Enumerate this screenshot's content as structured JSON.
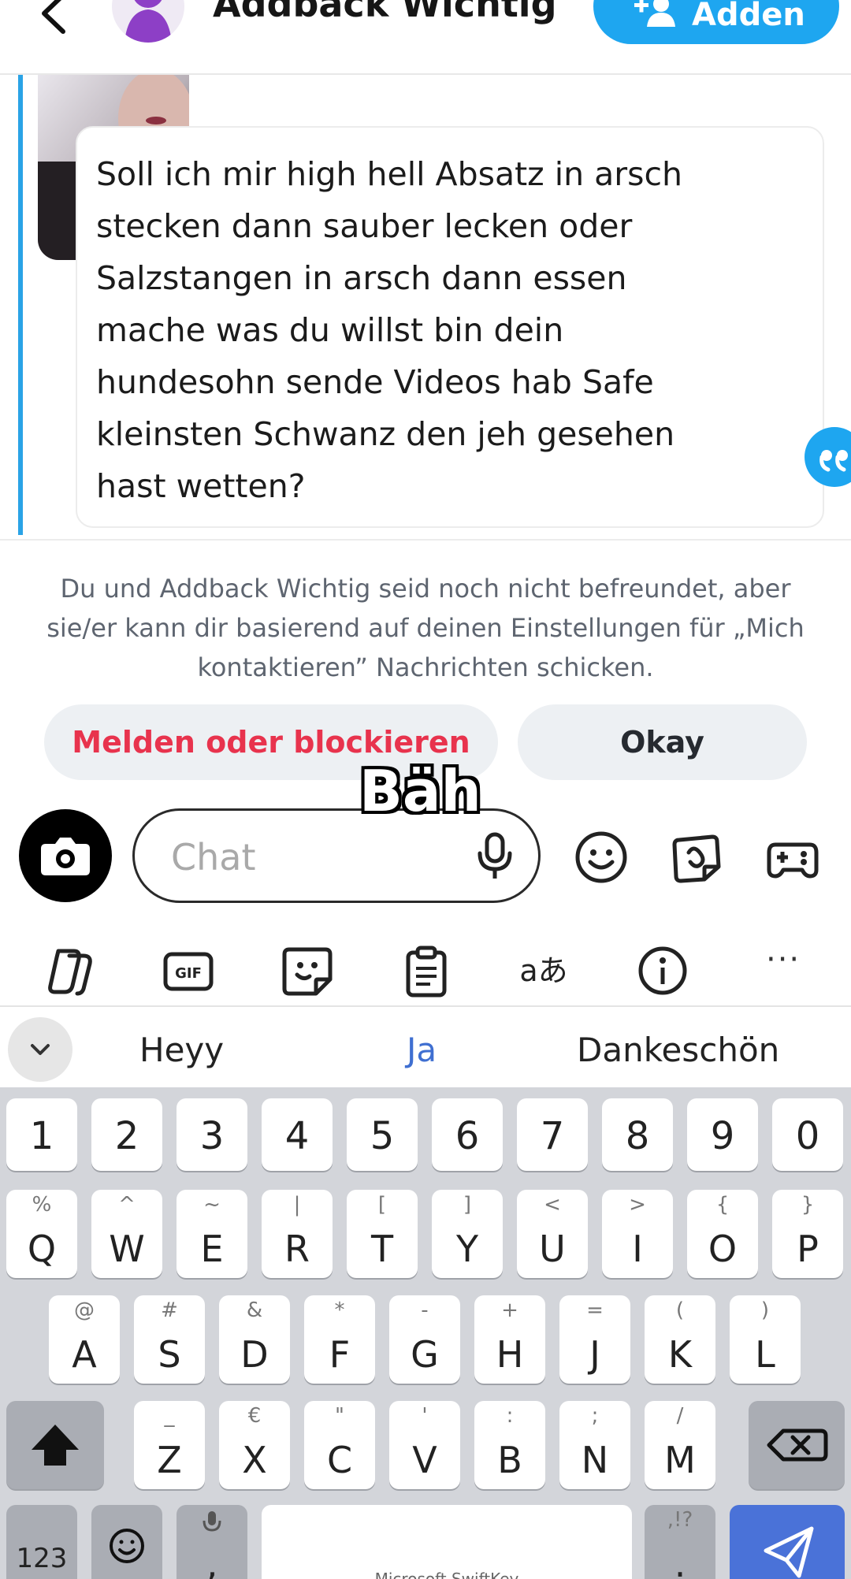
{
  "header": {
    "title": "Addback Wichtig",
    "add_label": "Adden"
  },
  "message": {
    "text": "Soll ich mir high hell Absatz in arsch stecken dann sauber lecken oder Salzstangen in arsch dann essen mache was du willst bin dein hundesohn sende Videos hab Safe kleinsten Schwanz den jeh gesehen hast wetten?"
  },
  "notice": {
    "text": "Du und Addback Wichtig seid noch nicht befreundet, aber sie/er kann dir basierend auf deinen Einstellungen für „Mich kontaktieren” Nachrichten schicken.",
    "report_label": "Melden oder blockieren",
    "okay_label": "Okay"
  },
  "caption": "Bäh",
  "chat": {
    "placeholder": "Chat"
  },
  "keyboard_toolbar": {
    "gif_label": "GIF",
    "translate_label": "aあ",
    "more_label": "···"
  },
  "suggestions": [
    "Heyy",
    "Ja",
    "Dankeschön"
  ],
  "keys": {
    "numbers": [
      "1",
      "2",
      "3",
      "4",
      "5",
      "6",
      "7",
      "8",
      "9",
      "0"
    ],
    "row1": [
      {
        "main": "Q",
        "sub": "%"
      },
      {
        "main": "W",
        "sub": "^"
      },
      {
        "main": "E",
        "sub": "~"
      },
      {
        "main": "R",
        "sub": "|"
      },
      {
        "main": "T",
        "sub": "["
      },
      {
        "main": "Y",
        "sub": "]"
      },
      {
        "main": "U",
        "sub": "<"
      },
      {
        "main": "I",
        "sub": ">"
      },
      {
        "main": "O",
        "sub": "{"
      },
      {
        "main": "P",
        "sub": "}"
      }
    ],
    "row2": [
      {
        "main": "A",
        "sub": "@"
      },
      {
        "main": "S",
        "sub": "#"
      },
      {
        "main": "D",
        "sub": "&"
      },
      {
        "main": "F",
        "sub": "*"
      },
      {
        "main": "G",
        "sub": "-"
      },
      {
        "main": "H",
        "sub": "+"
      },
      {
        "main": "J",
        "sub": "="
      },
      {
        "main": "K",
        "sub": "("
      },
      {
        "main": "L",
        "sub": ")"
      }
    ],
    "row3": [
      {
        "main": "Z",
        "sub": "_"
      },
      {
        "main": "X",
        "sub": "€"
      },
      {
        "main": "C",
        "sub": "\""
      },
      {
        "main": "V",
        "sub": "'"
      },
      {
        "main": "B",
        "sub": ":"
      },
      {
        "main": "N",
        "sub": ";"
      },
      {
        "main": "M",
        "sub": "/"
      }
    ],
    "bottom": {
      "numbers_label": "123",
      "comma_label": ",",
      "space_brand": "Microsoft SwiftKey",
      "period_label": ".",
      "period_sub": ",!?"
    }
  },
  "colors": {
    "accent_blue": "#1ea6f0",
    "report_red": "#e8334d",
    "suggestion_highlight": "#3f6fd1",
    "send_key": "#4a72d8"
  }
}
